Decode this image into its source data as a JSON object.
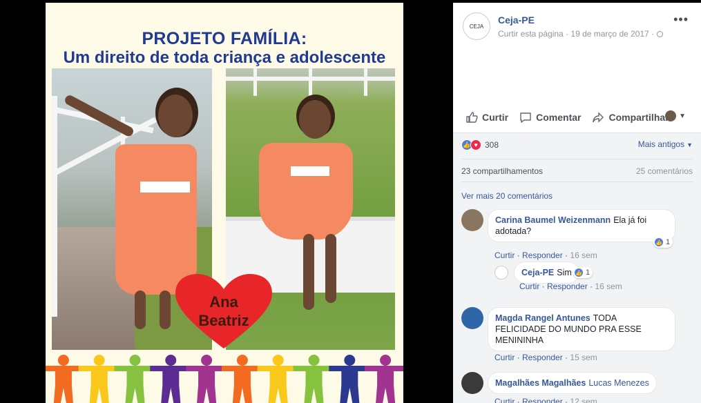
{
  "photo": {
    "headline_line1": "PROJETO FAMÍLIA:",
    "headline_line2": "Um direito de toda criança e adolescente",
    "heart_line1": "Ana",
    "heart_line2": "Beatriz",
    "heart_color": "#e8262a",
    "people_colors": [
      "#f26b21",
      "#f9c81a",
      "#86c23f",
      "#5b2c91",
      "#a2348f",
      "#f26b21",
      "#f9c81a",
      "#86c23f",
      "#2b3990",
      "#a2348f"
    ]
  },
  "post": {
    "page_name": "Ceja-PE",
    "avatar_text": "CEJA",
    "like_page": "Curtir esta página",
    "separator": "·",
    "date": "19 de março de 2017",
    "more": "•••",
    "actions": {
      "like": "Curtir",
      "comment": "Comentar",
      "share": "Compartilhar"
    }
  },
  "feedback": {
    "reaction_count": "308",
    "sort_label": "Mais antigos",
    "shares": "23 compartilhamentos",
    "comments": "25 comentários",
    "more_comments": "Ver mais 20 comentários"
  },
  "comments": [
    {
      "name": "Carina Baumel Weizenmann",
      "text": "Ela já foi adotada?",
      "like": "Curtir",
      "reply": "Responder",
      "time": "16 sem",
      "likes": "1"
    },
    {
      "name": "Ceja-PE",
      "text": "Sim",
      "like": "Curtir",
      "reply": "Responder",
      "time": "16 sem",
      "likes": "1"
    },
    {
      "name": "Magda Rangel Antunes",
      "text": "TODA FELICIDADE DO MUNDO PRA ESSE MENININHA",
      "like": "Curtir",
      "reply": "Responder",
      "time": "15 sem"
    },
    {
      "name": "Magalhães Magalhães",
      "text": "Lucas Menezes",
      "like": "Curtir",
      "reply": "Responder",
      "time": "12 sem"
    }
  ],
  "colors": {
    "link": "#365899",
    "meta": "#90949c",
    "headline": "#1f3a8f"
  }
}
